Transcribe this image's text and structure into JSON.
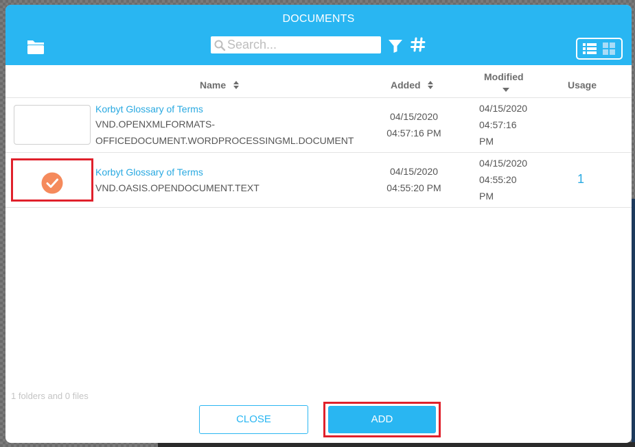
{
  "header": {
    "title": "DOCUMENTS",
    "search_placeholder": "Search..."
  },
  "columns": {
    "name": "Name",
    "added": "Added",
    "modified": "Modified",
    "usage": "Usage"
  },
  "rows": [
    {
      "name": "Korbyt Glossary of Terms",
      "type_line1": "VND.OPENXMLFORMATS-",
      "type_line2": "OFFICEDOCUMENT.WORDPROCESSINGML.DOCUMENT",
      "added_date": "04/15/2020",
      "added_time": "04:57:16 PM",
      "modified_date": "04/15/2020",
      "modified_time": "04:57:16",
      "modified_ampm": "PM",
      "usage": "",
      "selected": false
    },
    {
      "name": "Korbyt Glossary of Terms",
      "type_line1": "VND.OASIS.OPENDOCUMENT.TEXT",
      "added_date": "04/15/2020",
      "added_time": "04:55:20 PM",
      "modified_date": "04/15/2020",
      "modified_time": "04:55:20",
      "modified_ampm": "PM",
      "usage": "1",
      "selected": true
    }
  ],
  "footer": {
    "status": "1 folders and 0 files",
    "close_label": "CLOSE",
    "add_label": "ADD"
  },
  "colors": {
    "accent": "#29b6f2",
    "link": "#29a9e1",
    "highlight": "#e0202b",
    "check": "#f58a5c"
  },
  "icons": {
    "folder": "folder-icon",
    "search": "search-icon",
    "filter": "filter-icon",
    "hash": "hash-icon",
    "list_view": "list-view-icon",
    "grid_view": "grid-view-icon",
    "sort": "sort-icon",
    "check": "check-circle-icon"
  }
}
